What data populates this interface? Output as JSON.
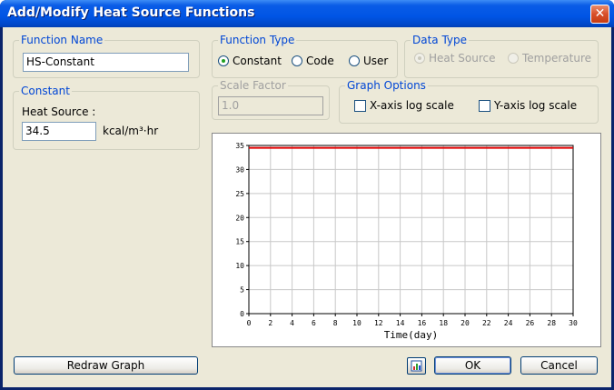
{
  "window": {
    "title": "Add/Modify Heat Source Functions",
    "close_glyph": "✕"
  },
  "function_name": {
    "legend": "Function Name",
    "value": "HS-Constant"
  },
  "constant": {
    "legend": "Constant",
    "label": "Heat Source :",
    "value": "34.5",
    "unit": "kcal/m³·hr"
  },
  "function_type": {
    "legend": "Function Type",
    "options": [
      {
        "label": "Constant",
        "selected": true
      },
      {
        "label": "Code",
        "selected": false
      },
      {
        "label": "User",
        "selected": false
      }
    ]
  },
  "data_type": {
    "legend": "Data Type",
    "options": [
      {
        "label": "Heat Source",
        "selected": true,
        "enabled": false
      },
      {
        "label": "Temperature",
        "selected": false,
        "enabled": false
      }
    ]
  },
  "scale_factor": {
    "legend": "Scale Factor",
    "value": "1.0"
  },
  "graph_options": {
    "legend": "Graph Options",
    "x_log_label": "X-axis log scale",
    "y_log_label": "Y-axis log scale",
    "x_log_checked": false,
    "y_log_checked": false
  },
  "buttons": {
    "redraw": "Redraw Graph",
    "ok": "OK",
    "cancel": "Cancel"
  },
  "icons": {
    "chart_icon": "chart-icon"
  },
  "colors": {
    "series": "#e00000",
    "grid": "#c8c8c8"
  },
  "chart_data": {
    "type": "line",
    "xlabel": "Time(day)",
    "ylabel": "",
    "xlim": [
      0,
      30
    ],
    "ylim": [
      0,
      35
    ],
    "x_ticks": [
      0,
      2,
      4,
      6,
      8,
      10,
      12,
      14,
      16,
      18,
      20,
      22,
      24,
      26,
      28,
      30
    ],
    "y_ticks": [
      0,
      5,
      10,
      15,
      20,
      25,
      30,
      35
    ],
    "grid": true,
    "series": [
      {
        "x": [
          0,
          30
        ],
        "y": [
          34.5,
          34.5
        ]
      }
    ]
  }
}
